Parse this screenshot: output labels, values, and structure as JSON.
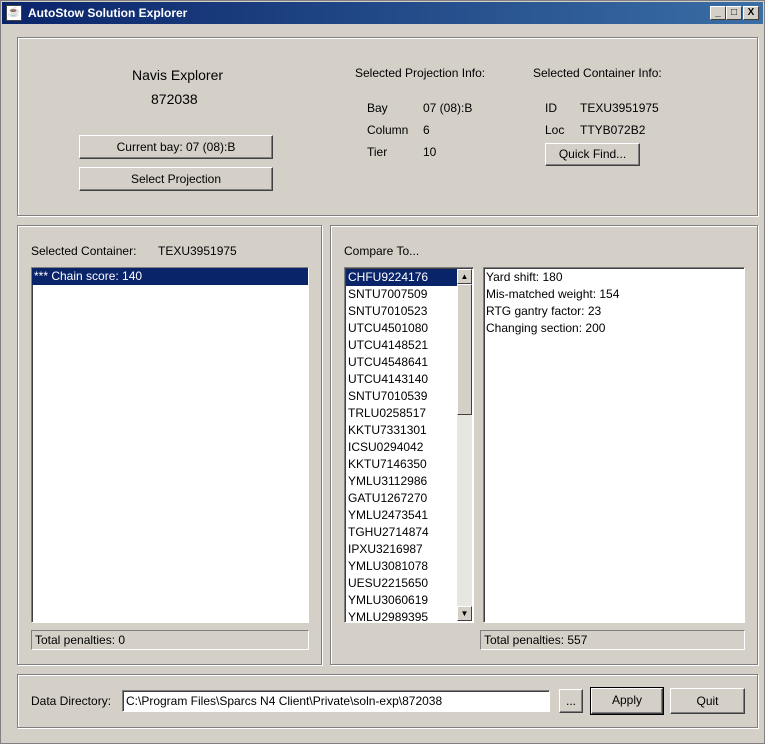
{
  "window": {
    "title": "AutoStow Solution Explorer",
    "minimize": "_",
    "maximize": "□",
    "close": "X"
  },
  "header": {
    "app_name": "Navis Explorer",
    "id": "872038",
    "current_bay_button": "Current bay: 07 (08):B",
    "select_projection_button": "Select Projection",
    "projection": {
      "title": "Selected Projection Info:",
      "bay_label": "Bay",
      "bay_value": "07 (08):B",
      "column_label": "Column",
      "column_value": "6",
      "tier_label": "Tier",
      "tier_value": "10"
    },
    "container": {
      "title": "Selected Container Info:",
      "id_label": "ID",
      "id_value": "TEXU3951975",
      "loc_label": "Loc",
      "loc_value": "TTYB072B2",
      "quick_find_button": "Quick Find..."
    }
  },
  "left_panel": {
    "label": "Selected Container:",
    "container_id": "TEXU3951975",
    "items": [
      "*** Chain score: 140"
    ],
    "total": "Total penalties: 0"
  },
  "right_panel": {
    "label": "Compare To...",
    "compare_list": [
      "CHFU9224176",
      "SNTU7007509",
      "SNTU7010523",
      "UTCU4501080",
      "UTCU4148521",
      "UTCU4548641",
      "UTCU4143140",
      "SNTU7010539",
      "TRLU0258517",
      "KKTU7331301",
      "ICSU0294042",
      "KKTU7146350",
      "YMLU3112986",
      "GATU1267270",
      "YMLU2473541",
      "TGHU2714874",
      "IPXU3216987",
      "YMLU3081078",
      "UESU2215650",
      "YMLU3060619",
      "YMLU2989395"
    ],
    "details": [
      "Yard shift: 180",
      "Mis-matched weight: 154",
      "RTG gantry factor: 23",
      "Changing section: 200"
    ],
    "total": "Total penalties: 557"
  },
  "footer": {
    "data_dir_label": "Data Directory:",
    "data_dir_value": "C:\\Program Files\\Sparcs N4 Client\\Private\\soln-exp\\872038",
    "browse_button": "...",
    "apply_button": "Apply",
    "quit_button": "Quit"
  },
  "colors": {
    "selection": "#0a246a",
    "background": "#d4d0c8",
    "title_gradient_start": "#0a246a",
    "title_gradient_end": "#3a6ea5"
  }
}
